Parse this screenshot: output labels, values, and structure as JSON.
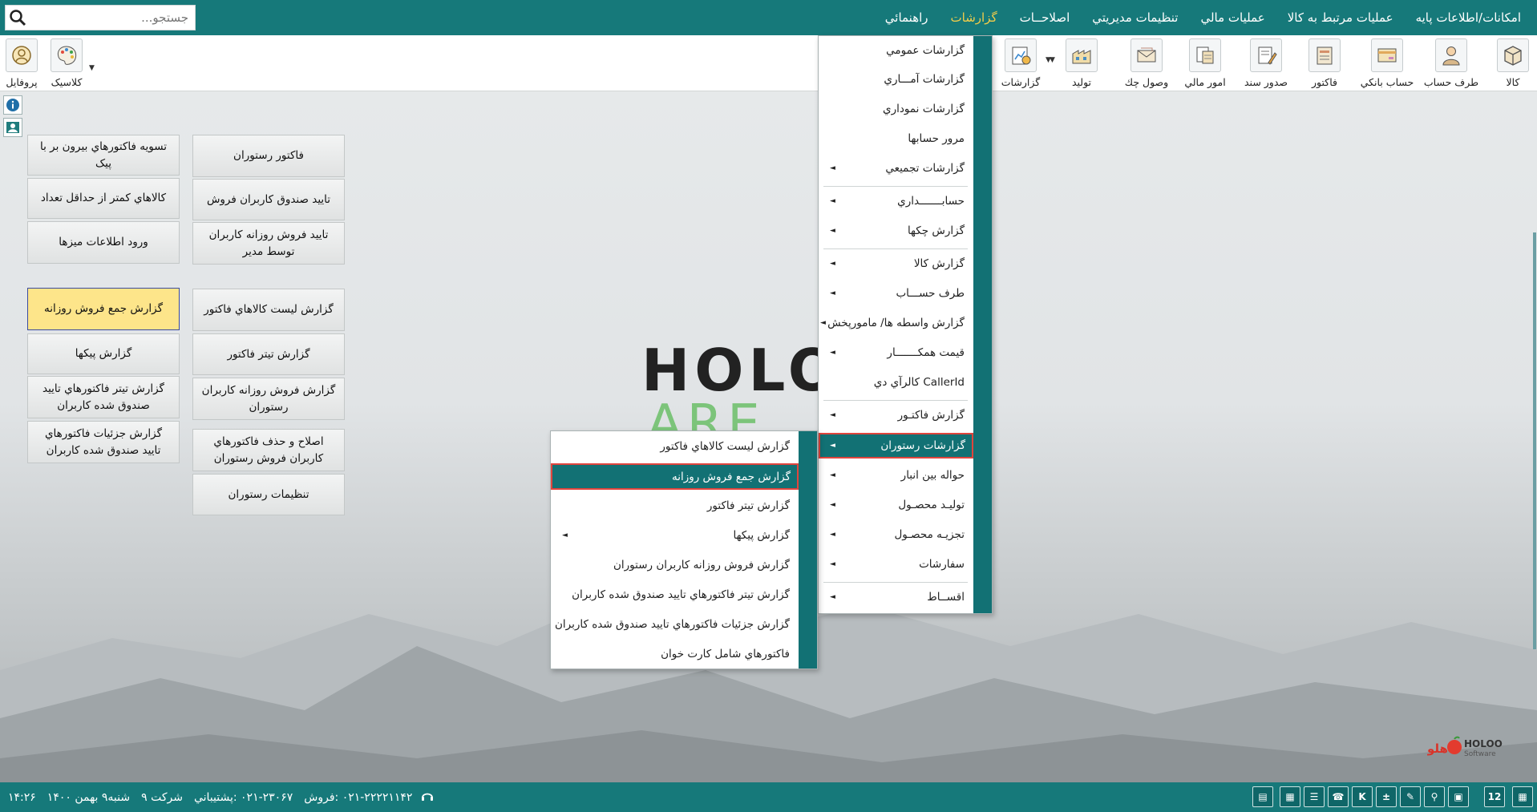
{
  "menubar": {
    "items": [
      "امکانات/اطلاعات پايه",
      "عمليات مرتبط به کالا",
      "عمليات مالي",
      "تنظيمات مديريتي",
      "اصلاحــات",
      "گزارشات",
      "راهنمائي"
    ],
    "active": "گزارشات"
  },
  "search": {
    "placeholder": "جستجو..."
  },
  "toolbar": {
    "items": [
      "کالا",
      "طرف حساب",
      "حساب بانکي",
      "فاکتور",
      "صدور سند",
      "امور مالي",
      "وصول چك",
      "توليد",
      "گزارشات",
      "کلاسیک",
      "پروفایل"
    ]
  },
  "quick_buttons": {
    "col1": [
      "تسويه فاکتورهاي بيرون بر با پيک",
      "کالاهاي کمتر از حداقل تعداد",
      "ورود اطلاعات ميزها",
      "گزارش جمع فروش روزانه",
      "گزارش پيکها",
      "گزارش تيتر فاکتورهاي تاييد صندوق شده کاربران",
      "گزارش جزئيات فاکتورهاي تاييد صندوق شده کاربران"
    ],
    "col2": [
      "فاکتور رستوران",
      "تاييد صندوق کاربران فروش",
      "تاييد فروش روزانه کاربران توسط مدير",
      "گزارش ليست کالاهاي فاکتور",
      "گزارش تيتر فاکتور",
      "گزارش فروش روزانه کاربران رستوران",
      "اصلاح و حذف فاکتورهاي کاربران فروش رستوران",
      "تنظيمات رستوران"
    ]
  },
  "logo": {
    "line1": "HOLO",
    "line2": "ARE"
  },
  "reports_menu": {
    "items": [
      "گزارشات عمومي",
      "گزارشات آمـــاري",
      "گزارشات نموداري",
      "مرور حسابها",
      "گزارشات تجميعي",
      "حسابـــــــداري",
      "گزارش چکها",
      "گزارش کالا",
      "طرف حســـاب",
      "گزارش واسطه ها/ مامورپخش",
      "قيمت همکـــــــار",
      "کالرآي دي CallerId",
      "گزارش فاکتـور",
      "گزارشات رستوران",
      "حواله بين انبار",
      "توليـد محصـول",
      "تجزيـه محصـول",
      "سفارشات",
      "اقســاط"
    ],
    "highlighted": "گزارشات رستوران"
  },
  "restaurant_submenu": {
    "items": [
      "گزارش ليست کالاهاي فاکتور",
      "گزارش جمع فروش روزانه",
      "گزارش تيتر فاکتور",
      "گزارش پيکها",
      "گزارش فروش روزانه کاربران رستوران",
      "گزارش تيتر فاکتورهاي تاييد صندوق شده کاربران",
      "گزارش جزئيات فاکتورهاي تاييد صندوق شده کاربران",
      "فاکتورهاي شامل کارت خوان"
    ],
    "highlighted": "گزارش جمع فروش روزانه"
  },
  "brand": {
    "fa": "هلو",
    "en1": "HOLOO",
    "en2": "Software"
  },
  "status": {
    "time": "۱۴:۲۶",
    "date": "شنبه۹ بهمن ۱۴۰۰",
    "company": "شرکت ۹",
    "support": "۰۲۱-۲۳۰۶۷ :پشتيباني",
    "sales": "۰۲۱-۲۲۲۲۱۱۴۲ :فروش",
    "calendar_day": "12"
  },
  "colors": {
    "primary": "#16797a",
    "active_menu": "#f2cd4a",
    "highlight_border": "#e0453d",
    "selected_button": "#fde58a"
  }
}
